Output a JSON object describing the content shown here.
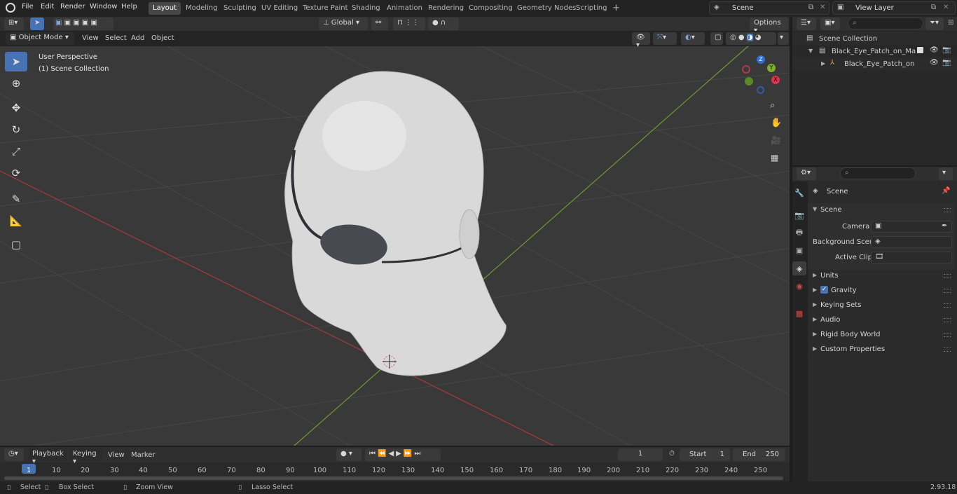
{
  "topbar": {
    "menus": [
      "File",
      "Edit",
      "Render",
      "Window",
      "Help"
    ],
    "tabs": [
      "Layout",
      "Modeling",
      "Sculpting",
      "UV Editing",
      "Texture Paint",
      "Shading",
      "Animation",
      "Rendering",
      "Compositing",
      "Geometry Nodes",
      "Scripting"
    ],
    "active_tab": "Layout",
    "scene": "Scene",
    "view_layer": "View Layer"
  },
  "header": {
    "orientation": "Global",
    "options": "Options"
  },
  "viewport": {
    "mode": "Object Mode",
    "menus": [
      "View",
      "Select",
      "Add",
      "Object"
    ],
    "perspective": "User Perspective",
    "collection": "(1) Scene Collection",
    "gizmo": {
      "x": "X",
      "y": "Y",
      "z": "Z"
    }
  },
  "outliner": {
    "root": "Scene Collection",
    "items": [
      "Black_Eye_Patch_on_Mannequ",
      "Black_Eye_Patch_on_Mar"
    ]
  },
  "properties": {
    "breadcrumb": "Scene",
    "section": "Scene",
    "camera_label": "Camera",
    "bg_scene_label": "Background Scene",
    "active_clip_label": "Active Clip",
    "panels": [
      "Units",
      "Gravity",
      "Keying Sets",
      "Audio",
      "Rigid Body World",
      "Custom Properties"
    ]
  },
  "timeline": {
    "menus": [
      "Playback",
      "Keying",
      "View",
      "Marker"
    ],
    "current_frame": "1",
    "start_label": "Start",
    "start": "1",
    "end_label": "End",
    "end": "250",
    "ticks": [
      "1",
      "10",
      "20",
      "30",
      "40",
      "50",
      "60",
      "70",
      "80",
      "90",
      "100",
      "110",
      "120",
      "130",
      "140",
      "150",
      "160",
      "170",
      "180",
      "190",
      "200",
      "210",
      "220",
      "230",
      "240",
      "250"
    ]
  },
  "status": {
    "select": "Select",
    "box_select": "Box Select",
    "zoom_view": "Zoom View",
    "lasso_select": "Lasso Select",
    "version": "2.93.18"
  }
}
